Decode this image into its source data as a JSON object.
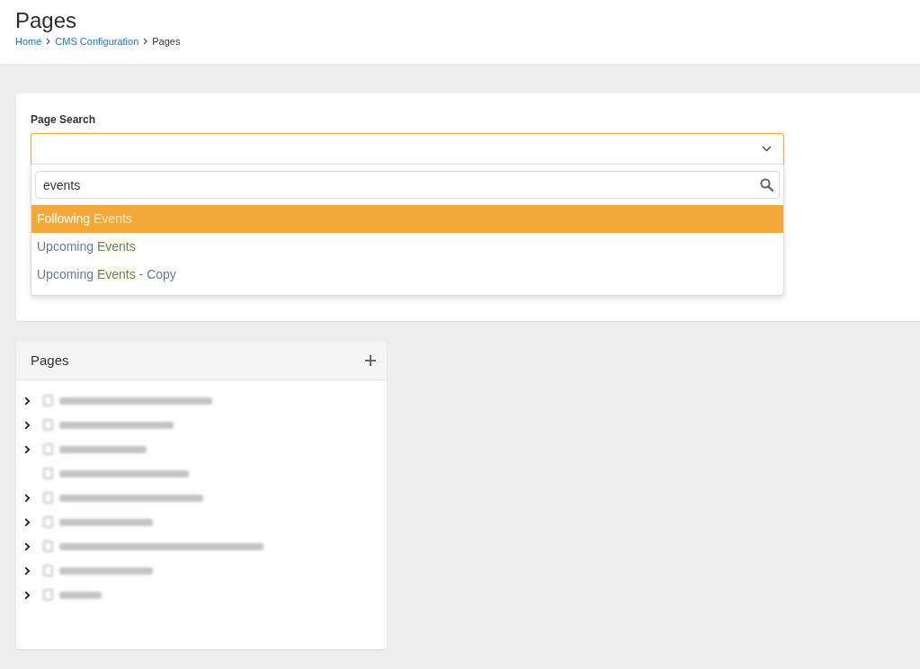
{
  "header": {
    "title": "Pages",
    "breadcrumb": [
      {
        "label": "Home",
        "current": false
      },
      {
        "label": "CMS Configuration",
        "current": false
      },
      {
        "label": "Pages",
        "current": true
      }
    ]
  },
  "page_search": {
    "label": "Page Search",
    "expanded": true,
    "filter": {
      "value": "events"
    },
    "options": [
      {
        "selected": true,
        "parts": [
          {
            "text": "Following ",
            "match": false
          },
          {
            "text": "Events",
            "match": true
          }
        ]
      },
      {
        "selected": false,
        "parts": [
          {
            "text": "Upcoming ",
            "match": false
          },
          {
            "text": "Events",
            "match": true
          }
        ]
      },
      {
        "selected": false,
        "parts": [
          {
            "text": "Upcoming ",
            "match": false
          },
          {
            "text": "Events",
            "match": true
          },
          {
            "text": " - Copy",
            "match": false
          }
        ]
      }
    ]
  },
  "pages_panel": {
    "title": "Pages",
    "items": [
      {
        "has_children": true
      },
      {
        "has_children": true
      },
      {
        "has_children": true
      },
      {
        "has_children": false
      },
      {
        "has_children": true
      },
      {
        "has_children": true
      },
      {
        "has_children": true
      },
      {
        "has_children": true
      },
      {
        "has_children": true
      }
    ]
  }
}
